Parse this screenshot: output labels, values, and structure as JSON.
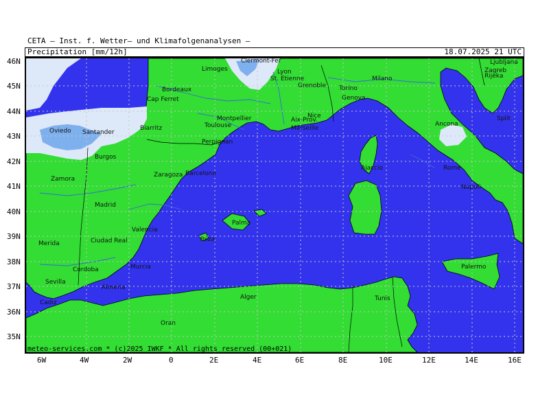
{
  "header": {
    "institute": "CETA — Inst. f. Wetter— und Klimafolgenanalysen —",
    "parameter": "Precipitation [mm/12h]",
    "datetime": "18.07.2025 21 UTC"
  },
  "footer": {
    "copyright": "meteo-services.com * (c)2025 IWKF * All rights reserved (00+021)"
  },
  "axes": {
    "latitudes": [
      "46N",
      "45N",
      "44N",
      "43N",
      "42N",
      "41N",
      "40N",
      "39N",
      "38N",
      "37N",
      "36N",
      "35N"
    ],
    "longitudes": [
      "6W",
      "4W",
      "2W",
      "0",
      "2E",
      "4E",
      "6E",
      "8E",
      "10E",
      "12E",
      "14E",
      "16E"
    ]
  },
  "cities": [
    "Clermont-Fer",
    "Limoges",
    "Lyon",
    "St. Etienne",
    "Bordeaux",
    "Grenoble",
    "Torino",
    "Milano",
    "Genova",
    "Cap Ferret",
    "Montpellier",
    "Toulouse",
    "Nice",
    "Aix-Prov.",
    "Marseille",
    "Biarritz",
    "Perpignan",
    "Oviedo",
    "Santander",
    "Burgos",
    "Ajaccio",
    "Barcelona",
    "Zaragoza",
    "Zamora",
    "Madrid",
    "Palma",
    "Valencia",
    "Ciudad Real",
    "Merida",
    "Ibiza",
    "Murcia",
    "Cordoba",
    "Sevilla",
    "Almeria",
    "Cadiz",
    "Alger",
    "Tunis",
    "Oran",
    "Ancona",
    "Rome",
    "Napoli",
    "Palermo",
    "Zagreb",
    "Rijeka",
    "Split",
    "Ljubljana"
  ],
  "colors": {
    "sea": "#3333ee",
    "land": "#33dd33",
    "precip_light": "#dde8f8",
    "precip_medium": "#7fb0ee",
    "river": "#3a6ad8",
    "grid": "#c8c8c8"
  }
}
